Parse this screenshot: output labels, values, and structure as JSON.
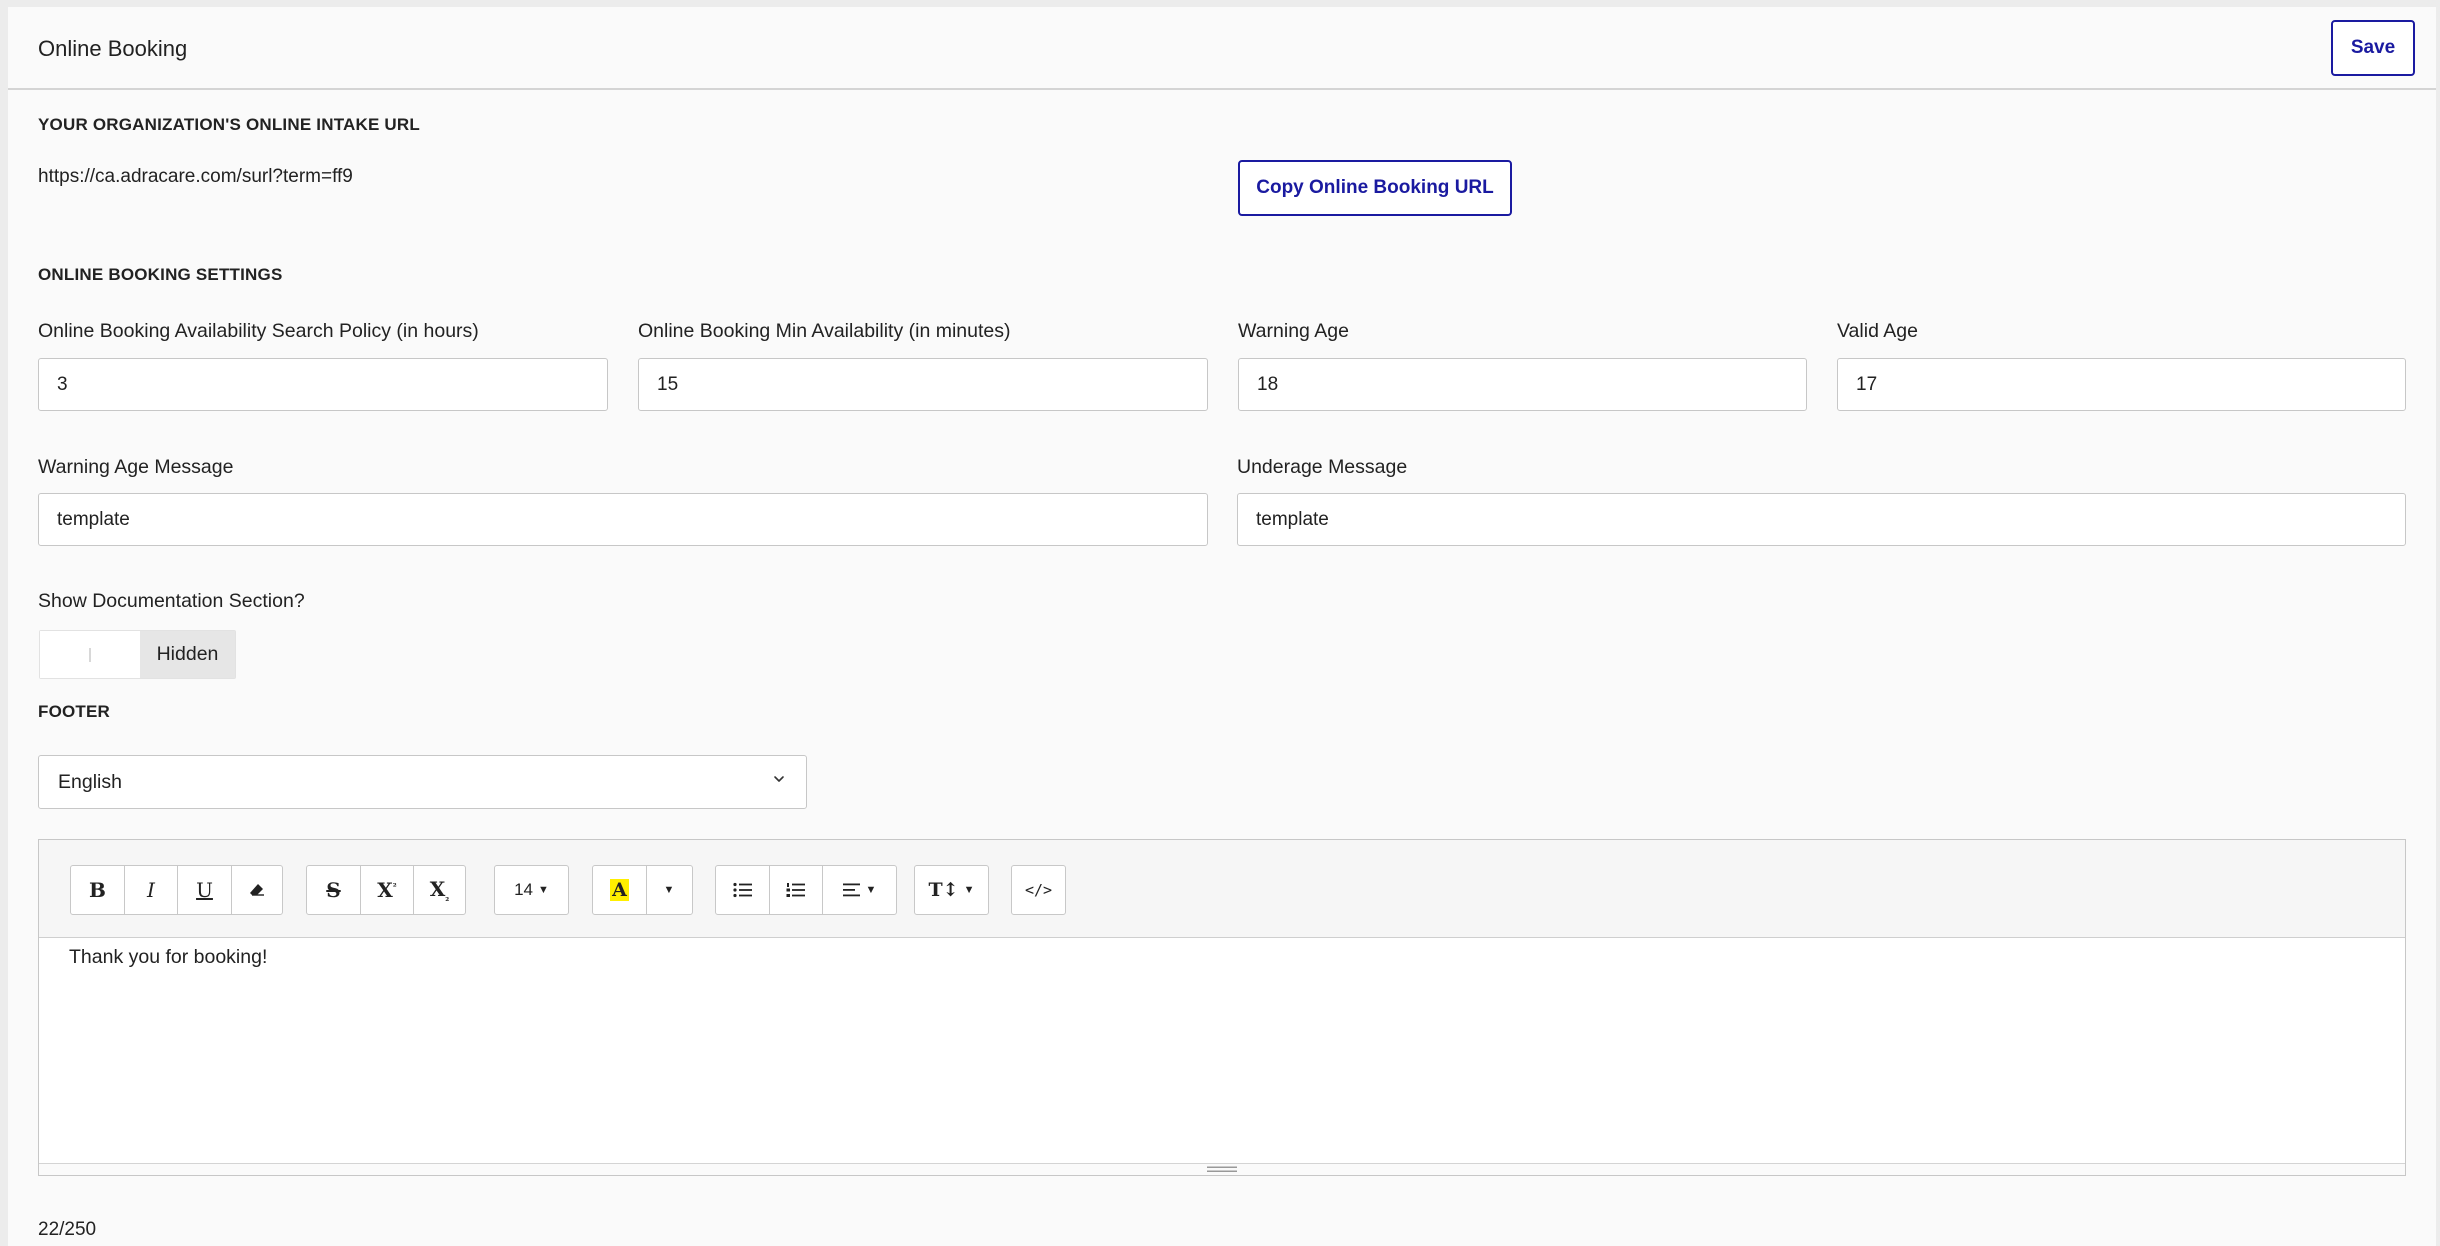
{
  "header": {
    "title": "Online Booking",
    "save_label": "Save"
  },
  "intake": {
    "heading": "YOUR ORGANIZATION'S ONLINE INTAKE URL",
    "url": "https://ca.adracare.com/surl?term=ff9",
    "copy_label": "Copy Online Booking URL"
  },
  "settings": {
    "heading": "ONLINE BOOKING SETTINGS",
    "fields": [
      {
        "label": "Online Booking Availability Search Policy (in hours)",
        "value": "3"
      },
      {
        "label": "Online Booking Min Availability (in minutes)",
        "value": "15"
      },
      {
        "label": "Warning Age",
        "value": "18"
      },
      {
        "label": "Valid Age",
        "value": "17"
      }
    ],
    "warning_message": {
      "label": "Warning Age Message",
      "value": "template"
    },
    "underage_message": {
      "label": "Underage Message",
      "value": "template"
    },
    "documentation": {
      "label": "Show Documentation Section?",
      "state": "Hidden",
      "enabled": false
    }
  },
  "footer": {
    "heading": "FOOTER",
    "language": "English",
    "toolbar": {
      "font_size": "14"
    },
    "content": "Thank you for booking!",
    "char_count": "22/250"
  },
  "colors": {
    "accent": "#1a1aa0",
    "highlight": "#ffef00"
  },
  "icons": [
    "bold-icon",
    "italic-icon",
    "underline-icon",
    "eraser-icon",
    "strikethrough-icon",
    "superscript-icon",
    "subscript-icon",
    "highlight-color-icon",
    "bullet-list-icon",
    "numbered-list-icon",
    "align-icon",
    "line-height-icon",
    "code-view-icon",
    "chevron-down-icon"
  ]
}
